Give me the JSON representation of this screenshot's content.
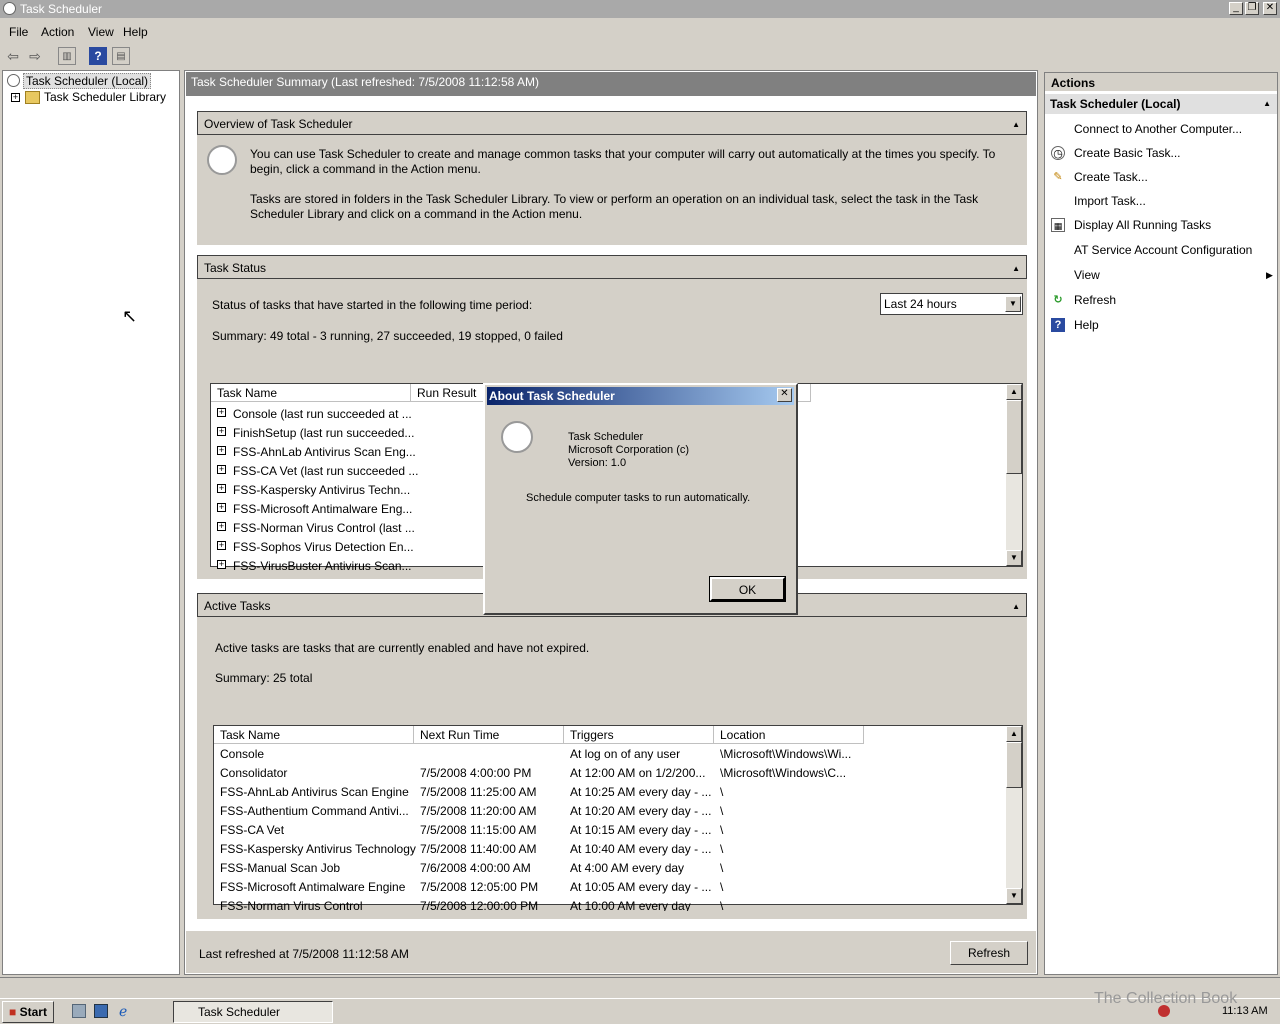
{
  "window": {
    "title": "Task Scheduler"
  },
  "menu": [
    "File",
    "Action",
    "View",
    "Help"
  ],
  "tree": {
    "root": "Task Scheduler (Local)",
    "library": "Task Scheduler Library"
  },
  "summary": {
    "header": "Task Scheduler Summary (Last refreshed: 7/5/2008 11:12:58 AM)"
  },
  "overview": {
    "title": "Overview of Task Scheduler",
    "p1_l1": "You can use Task Scheduler to create and manage common tasks that your computer will carry out automatically at the times you specify. To",
    "p1_l2": "begin, click a command in the Action menu.",
    "p2_l1": "Tasks are stored in folders in the Task Scheduler Library. To view or perform an operation on an individual task, select the task in the Task",
    "p2_l2": "Scheduler Library and click on a command in the Action menu."
  },
  "status": {
    "title": "Task Status",
    "period_label": "Status of tasks that have started in the following time period:",
    "period_value": "Last 24 hours",
    "summary": "Summary: 49 total - 3 running, 27 succeeded, 19 stopped, 0 failed",
    "col_name": "Task Name",
    "col_result": "Run Result",
    "rows": [
      "Console (last run succeeded at ...",
      "FinishSetup (last run succeeded...",
      "FSS-AhnLab Antivirus Scan Eng...",
      "FSS-CA Vet (last run succeeded ...",
      "FSS-Kaspersky Antivirus Techn...",
      "FSS-Microsoft Antimalware Eng...",
      "FSS-Norman Virus Control (last ...",
      "FSS-Sophos Virus Detection En...",
      "FSS-VirusBuster Antivirus Scan..."
    ]
  },
  "active": {
    "title": "Active Tasks",
    "desc": "Active tasks are tasks that are currently enabled and have not expired.",
    "summary": "Summary: 25 total",
    "cols": [
      "Task Name",
      "Next Run Time",
      "Triggers",
      "Location"
    ],
    "rows": [
      [
        "Console",
        "",
        "At log on of any user",
        "\\Microsoft\\Windows\\Wi..."
      ],
      [
        "Consolidator",
        "7/5/2008 4:00:00 PM",
        "At 12:00 AM on 1/2/200...",
        "\\Microsoft\\Windows\\C..."
      ],
      [
        "FSS-AhnLab Antivirus Scan Engine",
        "7/5/2008 11:25:00 AM",
        "At 10:25 AM every day - ...",
        "\\"
      ],
      [
        "FSS-Authentium Command Antivi...",
        "7/5/2008 11:20:00 AM",
        "At 10:20 AM every day - ...",
        "\\"
      ],
      [
        "FSS-CA Vet",
        "7/5/2008 11:15:00 AM",
        "At 10:15 AM every day - ...",
        "\\"
      ],
      [
        "FSS-Kaspersky Antivirus Technology",
        "7/5/2008 11:40:00 AM",
        "At 10:40 AM every day - ...",
        "\\"
      ],
      [
        "FSS-Manual Scan Job",
        "7/6/2008 4:00:00 AM",
        "At 4:00 AM every day",
        "\\"
      ],
      [
        "FSS-Microsoft Antimalware Engine",
        "7/5/2008 12:05:00 PM",
        "At 10:05 AM every day - ...",
        "\\"
      ],
      [
        "FSS-Norman Virus Control",
        "7/5/2008 12:00:00 PM",
        "At 10:00 AM every day",
        "\\"
      ]
    ]
  },
  "footer": {
    "last_refreshed": "Last refreshed at 7/5/2008 11:12:58 AM",
    "refresh": "Refresh"
  },
  "actions": {
    "title": "Actions",
    "group": "Task Scheduler (Local)",
    "items": [
      "Connect to Another Computer...",
      "Create Basic Task...",
      "Create Task...",
      "Import Task...",
      "Display All Running Tasks",
      "AT Service Account Configuration",
      "View",
      "Refresh",
      "Help"
    ]
  },
  "dialog": {
    "title": "About Task Scheduler",
    "name": "Task Scheduler",
    "company": "Microsoft Corporation (c)",
    "version": "Version: 1.0",
    "desc": "Schedule computer tasks to run automatically.",
    "ok": "OK"
  },
  "taskbar": {
    "start": "Start",
    "task": "Task Scheduler",
    "clock": "11:13 AM",
    "watermark": "The Collection Book"
  }
}
